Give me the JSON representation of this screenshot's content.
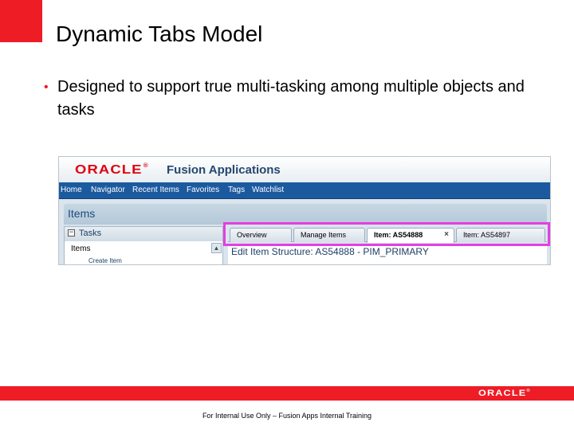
{
  "slide": {
    "title": "Dynamic Tabs Model",
    "bullet": "Designed to support true multi-tasking among multiple objects and tasks",
    "footer_note": "For Internal Use Only – Fusion Apps Internal Training",
    "footer_logo": "ORACLE"
  },
  "app": {
    "logo": "ORACLE",
    "name": "Fusion Applications",
    "nav": [
      "Home",
      "Navigator",
      "Recent Items",
      "Favorites",
      "Tags",
      "Watchlist"
    ],
    "page_title": "Items",
    "tasks_label": "Tasks",
    "tasks_sub": "Items",
    "tasks_sub2": "Create Item",
    "tabs": [
      {
        "label": "Overview"
      },
      {
        "label": "Manage Items"
      },
      {
        "label": "Item: AS54888",
        "close": "×"
      },
      {
        "label": "Item: AS54897"
      }
    ],
    "edit_title": "Edit Item Structure: AS54888 - PIM_PRIMARY"
  },
  "colors": {
    "brand_red": "#ee1c25",
    "highlight": "#e43fe0",
    "nav_blue": "#1c5aa0"
  },
  "icons": {
    "collapse": "minus-box-icon",
    "tab_close": "close-icon",
    "scroll": "scroll-up-icon"
  }
}
